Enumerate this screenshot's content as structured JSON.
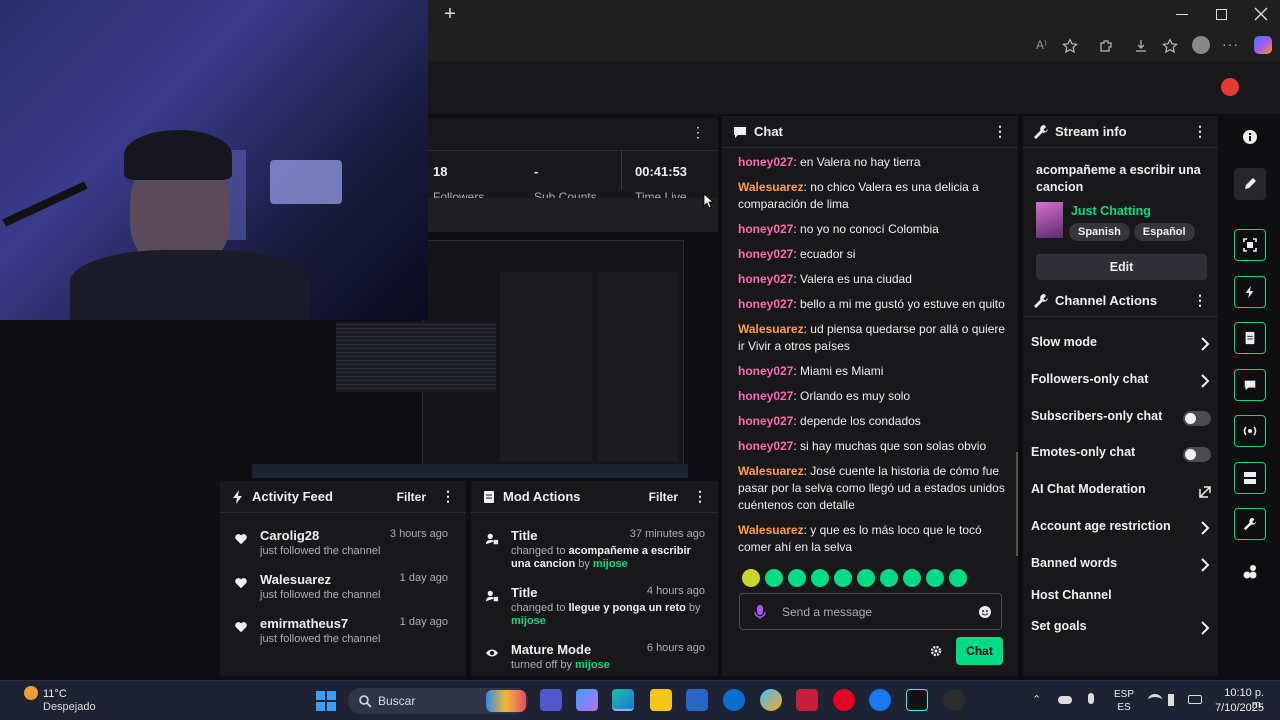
{
  "browser": {
    "new_tab_label": "+",
    "window_controls": [
      "minimize",
      "maximize",
      "close"
    ],
    "toolbar_icons": [
      "read-aloud-icon",
      "favorite-icon",
      "extensions-icon",
      "browser-essentials-icon",
      "favorites-bar-icon",
      "profile-icon",
      "more-icon",
      "copilot-icon"
    ]
  },
  "stats": {
    "followers_value": "18",
    "followers_label": "Followers",
    "subs_value": "-",
    "subs_label": "Sub Counts",
    "time_value": "00:41:53",
    "time_label": "Time Live"
  },
  "chat": {
    "title": "Chat",
    "messages": [
      {
        "user": "honey027",
        "color": "#ff69b4",
        "text": "en Valera no hay tierra"
      },
      {
        "user": "Walesuarez",
        "color": "#ff9f3a",
        "text": "no chico Valera es una delicia a comparación de lima"
      },
      {
        "user": "honey027",
        "color": "#ff69b4",
        "text": "no yo no conocí Colombia"
      },
      {
        "user": "honey027",
        "color": "#ff69b4",
        "text": "ecuador si"
      },
      {
        "user": "honey027",
        "color": "#ff69b4",
        "text": "Valera es una ciudad"
      },
      {
        "user": "honey027",
        "color": "#ff69b4",
        "text": "bello a mi me gustó yo estuve en quito"
      },
      {
        "user": "Walesuarez",
        "color": "#ff9f3a",
        "text": "ud piensa quedarse por allá o quiere ir Vivir a otros países"
      },
      {
        "user": "honey027",
        "color": "#ff69b4",
        "text": "Miami es Miami"
      },
      {
        "user": "honey027",
        "color": "#ff69b4",
        "text": "Orlando es muy solo"
      },
      {
        "user": "honey027",
        "color": "#ff69b4",
        "text": "depende los condados"
      },
      {
        "user": "honey027",
        "color": "#ff69b4",
        "text": "si hay muchas que son solas obvio"
      },
      {
        "user": "Walesuarez",
        "color": "#ff9f3a",
        "text": "José cuente la historia de cómo fue pasar por la selva como llegó ud a estados unidos cuéntenos con detalle"
      },
      {
        "user": "Walesuarez",
        "color": "#ff9f3a",
        "text": "y que es lo más loco que le tocó comer ahí en la selva"
      }
    ],
    "input_placeholder": "Send a message",
    "send_button": "Chat"
  },
  "stream_info": {
    "title": "Stream info",
    "stream_title": "acompañeme a escribir una cancion",
    "category": "Just Chatting",
    "tags": [
      "Spanish",
      "Español"
    ],
    "edit_button": "Edit"
  },
  "channel_actions": {
    "title": "Channel Actions",
    "items": [
      {
        "label": "Slow mode",
        "control": "chevron"
      },
      {
        "label": "Followers-only chat",
        "control": "chevron"
      },
      {
        "label": "Subscribers-only chat",
        "control": "toggle",
        "on": false
      },
      {
        "label": "Emotes-only chat",
        "control": "toggle",
        "on": false
      },
      {
        "label": "AI Chat Moderation",
        "control": "external"
      },
      {
        "label": "Account age restriction",
        "control": "chevron"
      },
      {
        "label": "Banned words",
        "control": "chevron"
      },
      {
        "label": "Host Channel",
        "control": "none"
      },
      {
        "label": "Set goals",
        "control": "chevron"
      }
    ]
  },
  "activity_feed": {
    "title": "Activity Feed",
    "filter": "Filter",
    "items": [
      {
        "name": "Carolig28",
        "desc": "just followed the channel",
        "time": "3 hours ago"
      },
      {
        "name": "Walesuarez",
        "desc": "just followed the channel",
        "time": "1 day ago"
      },
      {
        "name": "emirmatheus7",
        "desc": "just followed the channel",
        "time": "1 day ago"
      }
    ]
  },
  "mod_actions": {
    "title": "Mod Actions",
    "filter": "Filter",
    "items": [
      {
        "title": "Title",
        "time": "37 minutes ago",
        "pre": "changed to ",
        "value": "acompañeme a escribir una cancion",
        "by": " by ",
        "mod": "mijose"
      },
      {
        "title": "Title",
        "time": "4 hours ago",
        "pre": "changed to ",
        "value": "llegue y ponga un reto",
        "by": " by ",
        "mod": "mijose"
      },
      {
        "title": "Mature Mode",
        "time": "6 hours ago",
        "pre": "turned off by ",
        "value": "",
        "by": "",
        "mod": "mijose"
      }
    ]
  },
  "taskbar": {
    "temperature": "11°C",
    "weather": "Despejado",
    "search_placeholder": "Buscar",
    "lang_top": "ESP",
    "lang_bottom": "ES",
    "time": "10:10 p. m.",
    "date": "7/10/2025"
  },
  "colors": {
    "accent": "#00db84",
    "panel": "#18181b",
    "background": "#0e0e10",
    "user_pink": "#ff69b4",
    "user_orange": "#ff9f3a"
  }
}
